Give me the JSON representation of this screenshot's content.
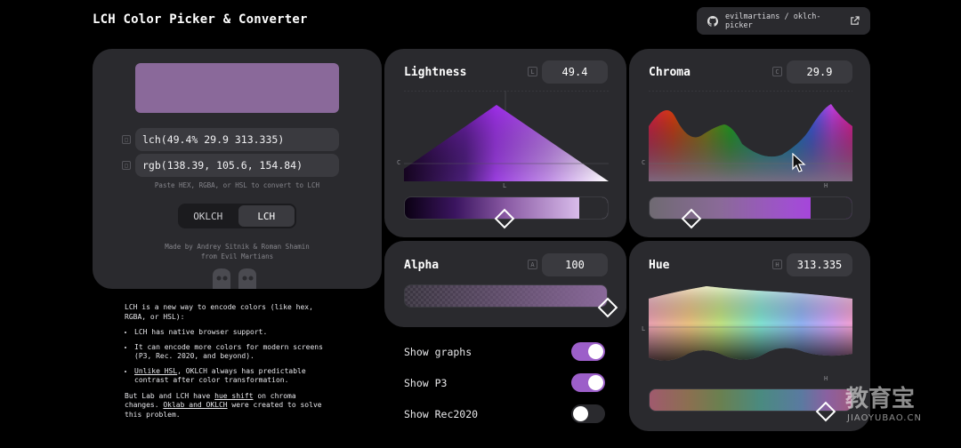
{
  "header": {
    "title": "LCH Color Picker & Converter",
    "repo_link": "evilmartians / oklch-picker"
  },
  "preview": {
    "color": "#8a699a"
  },
  "codes": {
    "lch": "lch(49.4% 29.9 313.335)",
    "rgb": "rgb(138.39, 105.6, 154.84)",
    "hint": "Paste HEX, RGBA, or HSL to convert to LCH"
  },
  "mode_toggle": {
    "options": [
      "OKLCH",
      "LCH"
    ],
    "active": "LCH"
  },
  "credits": {
    "line1": "Made by Andrey Sitnik & Roman Shamin",
    "line2": "from Evil Martians"
  },
  "panels": {
    "lightness": {
      "label": "Lightness",
      "key": "L",
      "value": "49.4",
      "axis_y": "C",
      "axis_x": "L",
      "slider_fraction": 0.494
    },
    "chroma": {
      "label": "Chroma",
      "key": "C",
      "value": "29.9",
      "axis_y": "C",
      "axis_x": "H",
      "slider_fraction": 0.21
    },
    "alpha": {
      "label": "Alpha",
      "key": "A",
      "value": "100",
      "slider_fraction": 1.0
    },
    "hue": {
      "label": "Hue",
      "key": "H",
      "value": "313.335",
      "axis_y": "L",
      "axis_x": "H",
      "slider_fraction": 0.87
    }
  },
  "options": [
    {
      "label": "Show graphs",
      "on": true
    },
    {
      "label": "Show P3",
      "on": true
    },
    {
      "label": "Show Rec2020",
      "on": false
    }
  ],
  "info": {
    "intro": "LCH is a new way to encode colors (like hex, RGBA, or HSL):",
    "bullets": [
      "LCH has native browser support.",
      "It can encode more colors for modern screens (P3, Rec. 2020, and beyond).",
      "always has predictable contrast after color transformation."
    ],
    "bullet3_link": "Unlike HSL",
    "bullet3_mid": ", OKLCH ",
    "outro_a": "But Lab and LCH have ",
    "outro_link1": "hue shift",
    "outro_b": " on chroma changes. ",
    "outro_link2": "Oklab and OKLCH",
    "outro_c": " were created to solve this problem."
  },
  "watermark": {
    "cn": "教育宝",
    "en": "JIAOYUBAO.CN"
  },
  "colors": {
    "accent": "#9c5fc9",
    "card": "#2a2a2e",
    "field": "#3a3a3f"
  }
}
